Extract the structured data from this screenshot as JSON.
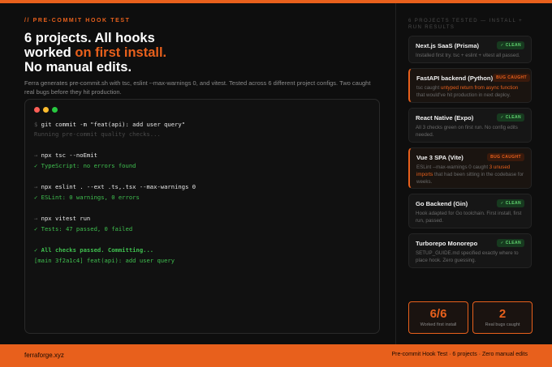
{
  "header": {
    "eyebrow": "// PRE-COMMIT HOOK TEST",
    "headline_a": "6 projects. All hooks",
    "headline_b": "worked ",
    "headline_hl": "on first install.",
    "headline_c": "No manual edits.",
    "subtitle": "Ferra generates pre-commit.sh with tsc, eslint --max-warnings 0, and vitest. Tested across 6 different project configs. Two caught real bugs before they hit production."
  },
  "terminal": {
    "lines": [
      {
        "prompt": "$",
        "text": "git commit -m \"feat(api): add user query\""
      },
      {
        "text": "Running pre-commit quality checks..."
      },
      {
        "prompt": "→",
        "text": "npx tsc --noEmit"
      },
      {
        "text": "✓ TypeScript: no errors found"
      },
      {
        "prompt": "→",
        "text": "npx eslint . --ext .ts,.tsx --max-warnings 0"
      },
      {
        "text": "✓ ESLint: 0 warnings, 0 errors"
      },
      {
        "prompt": "→",
        "text": "npx vitest run"
      },
      {
        "text": "✓ Tests: 47 passed, 0 failed"
      },
      {
        "text": "✓ All checks passed. Committing..."
      },
      {
        "text": "[main 3f2a1c4] feat(api): add user query"
      }
    ]
  },
  "sidebar": {
    "title": "6 PROJECTS TESTED — INSTALL + RUN RESULTS",
    "cards": [
      {
        "title": "Next.js SaaS (Prisma)",
        "badge": "✓ CLEAN",
        "desc": "Installed first try. tsc + eslint + vitest all passed."
      },
      {
        "title": "FastAPI backend (Python)",
        "badge": "BUG CAUGHT",
        "desc_a": "tsc caught ",
        "desc_hl": "untyped return from async function",
        "desc_b": " that would've hit production in next deploy."
      },
      {
        "title": "React Native (Expo)",
        "badge": "✓ CLEAN",
        "desc": "All 3 checks green on first run. No config edits needed."
      },
      {
        "title": "Vue 3 SPA (Vite)",
        "badge": "BUG CAUGHT",
        "desc_a": "ESLint --max-warnings 0 caught ",
        "desc_hl": "3 unused imports",
        "desc_b": " that had been sitting in the codebase for weeks."
      },
      {
        "title": "Go Backend (Gin)",
        "badge": "✓ CLEAN",
        "desc": "Hook adapted for Go toolchain. First install, first run, passed."
      },
      {
        "title": "Turborepo Monorepo",
        "badge": "✓ CLEAN",
        "desc": "SETUP_GUIDE.md specified exactly where to place hook. Zero guessing."
      }
    ],
    "stats": [
      {
        "value": "6/6",
        "label": "Worked first install"
      },
      {
        "value": "2",
        "label": "Real bugs caught"
      }
    ]
  },
  "footer": {
    "left": "ferraforge.xyz",
    "right": "Pre-commit Hook Test · 6 projects · Zero manual edits"
  },
  "colors": {
    "accent": "#e8601c",
    "success": "#3fbf4f",
    "background": "#0e0e0e"
  }
}
